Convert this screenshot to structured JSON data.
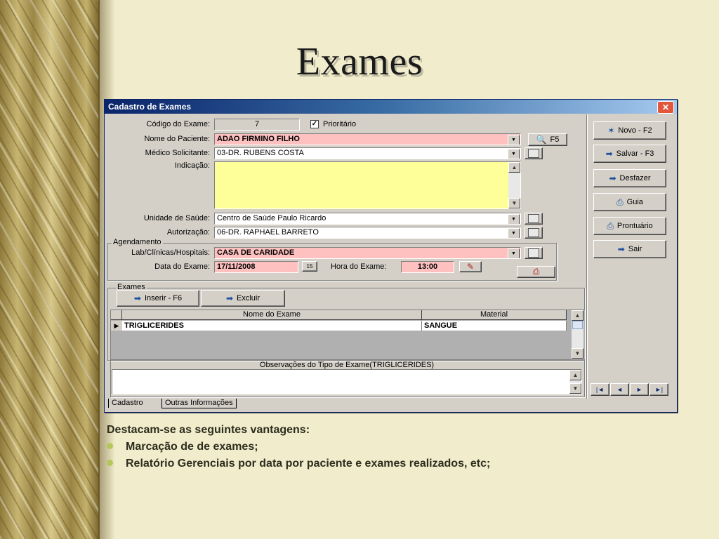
{
  "slide": {
    "title": "Exames",
    "intro": "Destacam-se as seguintes vantagens:",
    "bullets": [
      "Marcação de de exames;",
      "Relatório Gerenciais por data por paciente e exames realizados, etc;"
    ]
  },
  "window": {
    "title": "Cadastro de Exames",
    "close": "✕"
  },
  "form": {
    "codigo_label": "Código do Exame:",
    "codigo_value": "7",
    "prioritario_label": "Prioritário",
    "prioritario_checked": true,
    "paciente_label": "Nome do Paciente:",
    "paciente_value": "ADAO FIRMINO FILHO",
    "f5_label": "F5",
    "medico_label": "Médico Solicitante:",
    "medico_value": "03-DR. RUBENS COSTA",
    "indicacao_label": "Indicação:",
    "indicacao_value": "",
    "unidade_label": "Unidade de Saúde:",
    "unidade_value": "Centro de Saúde Paulo Ricardo",
    "autorizacao_label": "Autorização:",
    "autorizacao_value": "06-DR. RAPHAEL BARRETO"
  },
  "agendamento": {
    "group_title": "Agendamento",
    "lab_label": "Lab/Clínicas/Hospitais:",
    "lab_value": "CASA DE CARIDADE",
    "data_label": "Data do Exame:",
    "data_value": "17/11/2008",
    "calendar": "15",
    "hora_label": "Hora do Exame:",
    "hora_value": "13:00"
  },
  "exames": {
    "group_title": "Exames",
    "inserir_label": "Inserir - F6",
    "excluir_label": "Excluir",
    "columns": [
      "Nome do Exame",
      "Material"
    ],
    "rows": [
      {
        "nome": "TRIGLICERIDES",
        "material": "SANGUE"
      }
    ],
    "obs_title": "Observações do Tipo de Exame(TRIGLICERIDES)"
  },
  "sidebar": {
    "novo_label": "Novo - F2",
    "salvar_label": "Salvar - F3",
    "desfazer_label": "Desfazer",
    "guia_label": "Guia",
    "prontuario_label": "Prontuário",
    "sair_label": "Sair"
  },
  "nav": {
    "first": "|◄",
    "prev": "◄",
    "next": "►",
    "last": "►|"
  },
  "tabs": [
    "Cadastro",
    "Outras Informações"
  ],
  "colors": {
    "required_field": "#ffc0c0",
    "memo_field": "#ffff99",
    "titlebar": "#0a246a"
  }
}
